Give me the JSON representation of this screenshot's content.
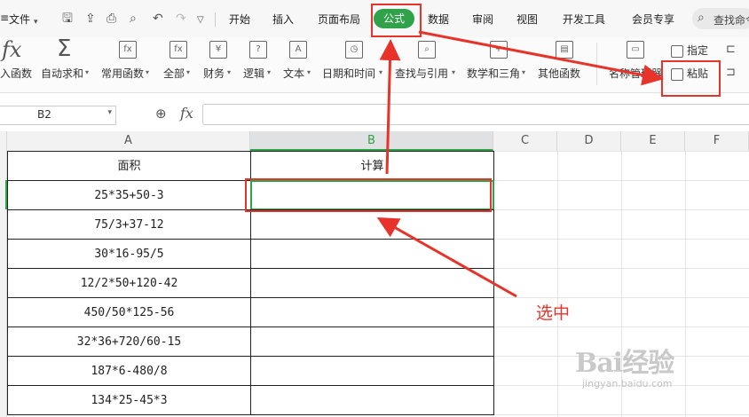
{
  "menubar": {
    "menu_icon": "≡",
    "file_label": "文件",
    "tabs": [
      "开始",
      "插入",
      "页面布局",
      "公式",
      "数据",
      "审阅",
      "视图",
      "开发工具",
      "会员专享"
    ],
    "active_tab": "公式",
    "search_label": "查找命令",
    "accent_color": "#2fa24a"
  },
  "ribbon": {
    "insert_function": "入函数",
    "insert_function_icon": "fx",
    "buttons": [
      "自动求和",
      "常用函数",
      "全部",
      "财务",
      "逻辑",
      "文本",
      "日期和时间",
      "查找与引用",
      "数学和三角",
      "其他函数"
    ],
    "icon_glyphs": [
      "Σ",
      "fx",
      "fx",
      "¥",
      "?",
      "A",
      "◷",
      "⌕",
      "+",
      "▤"
    ],
    "name_manager": "名称管理器",
    "specify": "指定",
    "paste": "粘贴"
  },
  "formula_bar": {
    "cell_ref": "B2",
    "fx_label": "fx",
    "value": ""
  },
  "sheet": {
    "columns": [
      "A",
      "B",
      "C",
      "D",
      "E",
      "F"
    ],
    "selected_column": "B",
    "header_row": [
      "面积",
      "计算"
    ],
    "rows": [
      "25*35+50-3",
      "75/3+37-12",
      "30*16-95/5",
      "12/2*50+120-42",
      "450/50*125-56",
      "32*36+720/60-15",
      "187*6-480/8",
      "134*25-45*3"
    ]
  },
  "annotation": {
    "note": "选中",
    "color": "#e8332a"
  },
  "watermark": {
    "logo": "Bai经验",
    "url": "jingyan.baidu.com"
  }
}
